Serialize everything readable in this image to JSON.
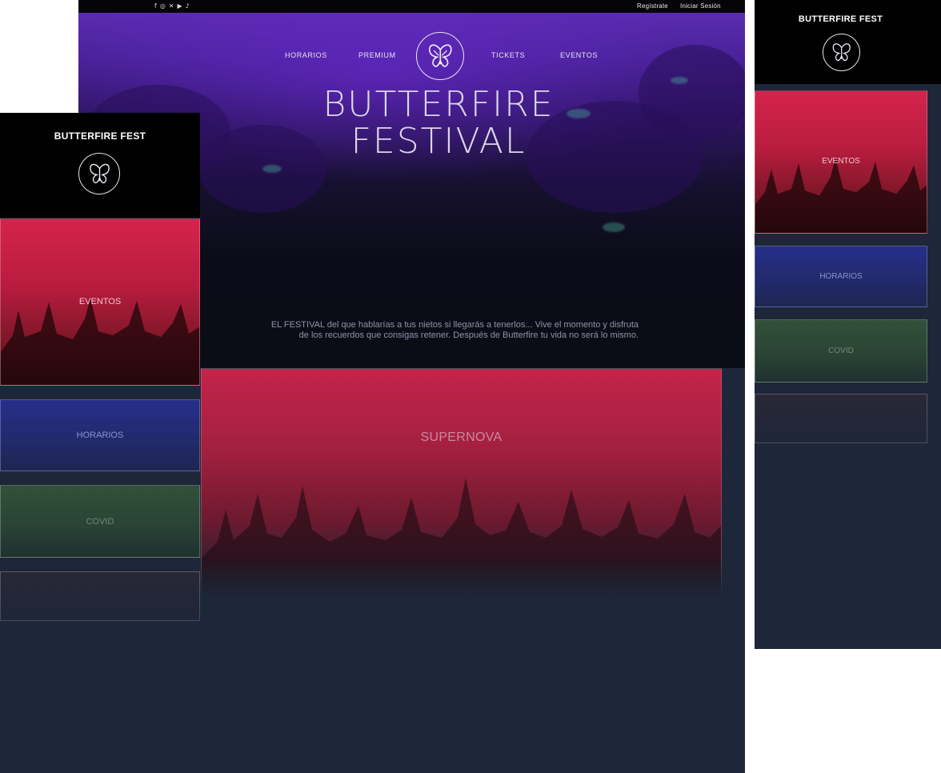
{
  "desktop": {
    "topbar": {
      "social_icons": [
        "facebook-icon",
        "instagram-icon",
        "twitter-icon",
        "youtube-icon",
        "tiktok-icon"
      ],
      "social_glyphs": [
        "f",
        "◎",
        "✕",
        "▶",
        "♪"
      ],
      "register": "Regístrate",
      "login": "Iniciar Sesión"
    },
    "nav": {
      "items": [
        "HORARIOS",
        "PREMIUM",
        "TICKETS",
        "EVENTOS"
      ]
    },
    "hero": {
      "title_line1": "BUTTERFIRE",
      "title_line2": "FESTIVAL"
    },
    "intro": {
      "line1": "EL FESTIVAL del que hablarías a tus nietos si llegarás a tenerlos... Vive el momento y disfruta",
      "line2": "de los recuerdos que consigas retener. Después de Butterfire tu vida no será lo mismo."
    },
    "feature_card": {
      "label": "SUPERNOVA"
    }
  },
  "mobile_left": {
    "brand": "BUTTERFIRE FEST",
    "cards": [
      "EVENTOS",
      "HORARIOS",
      "COVID"
    ]
  },
  "mobile_right": {
    "brand": "BUTTERFIRE FEST",
    "cards": [
      "EVENTOS",
      "HORARIOS",
      "COVID"
    ]
  },
  "colors": {
    "background": "#1d2739",
    "hero_purple": "#5b2bb0",
    "card_red": "#d5234c",
    "card_blue": "#262f8a",
    "card_green": "#31513a"
  }
}
